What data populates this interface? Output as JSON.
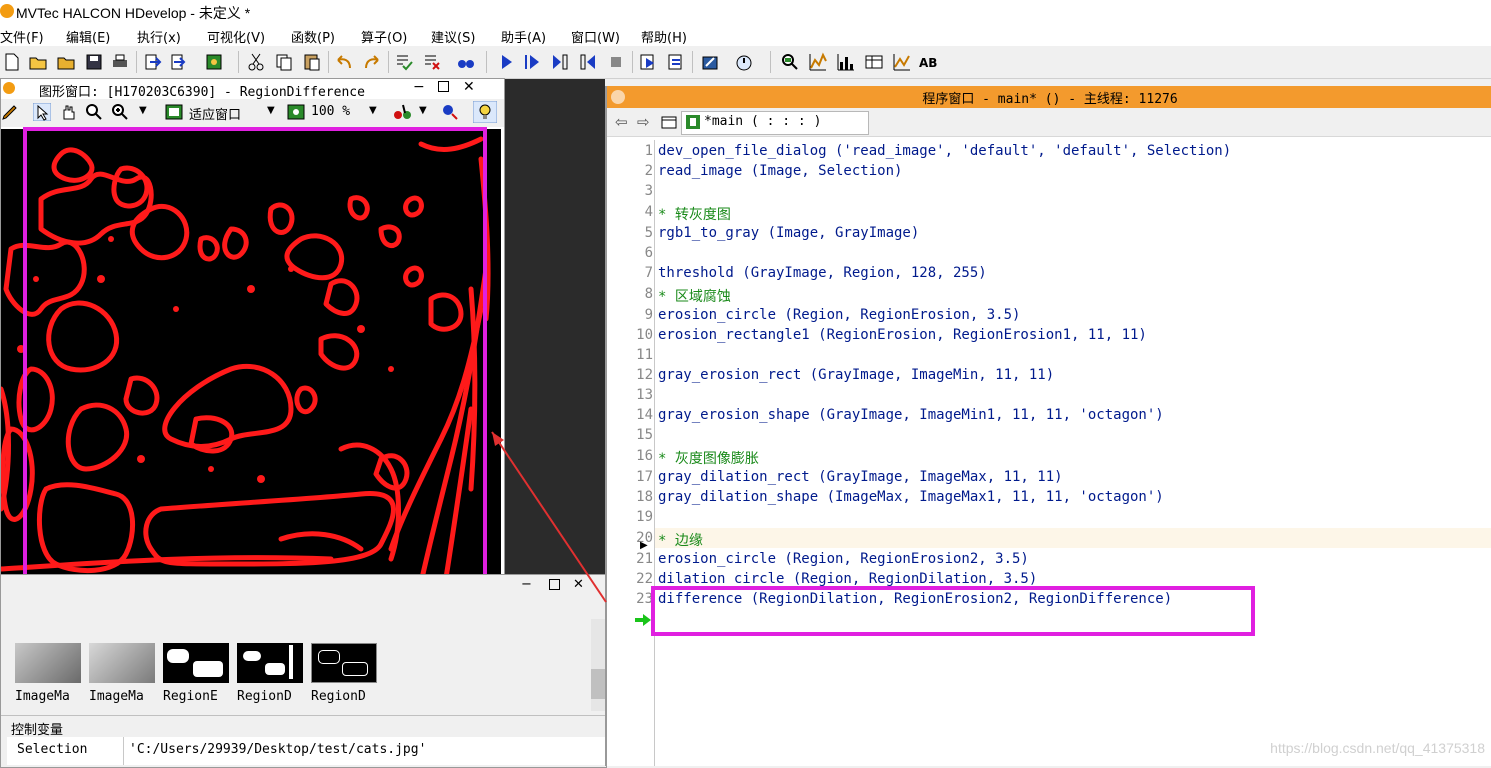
{
  "app": {
    "title": "MVTec HALCON HDevelop - 未定义 *"
  },
  "menu": [
    "文件(F)",
    "编辑(E)",
    "执行(x)",
    "可视化(V)",
    "函数(P)",
    "算子(O)",
    "建议(S)",
    "助手(A)",
    "窗口(W)",
    "帮助(H)"
  ],
  "graphics_window": {
    "title": "图形窗口: [H170203C6390] - RegionDifference",
    "fit_label": "适应窗口",
    "zoom_label": "100 %"
  },
  "variables": {
    "thumbnails": [
      "ImageMa",
      "ImageMa",
      "RegionE",
      "RegionD",
      "RegionD"
    ],
    "control_header": "控制变量",
    "control_var_name": "Selection",
    "control_var_value": "'C:/Users/29939/Desktop/test/cats.jpg'"
  },
  "program_window": {
    "title": "程序窗口 - main* () - 主线程: 11276",
    "procedure": "*main ( : : : )",
    "lines": [
      {
        "n": "1",
        "text": "dev_open_file_dialog ('read_image', 'default', 'default', Selection)",
        "comment": false
      },
      {
        "n": "2",
        "text": "read_image (Image, Selection)",
        "comment": false
      },
      {
        "n": "3",
        "text": "",
        "comment": false
      },
      {
        "n": "4",
        "text": "* 转灰度图",
        "comment": true
      },
      {
        "n": "5",
        "text": "rgb1_to_gray (Image, GrayImage)",
        "comment": false
      },
      {
        "n": "6",
        "text": "",
        "comment": false
      },
      {
        "n": "7",
        "text": "threshold (GrayImage, Region, 128, 255)",
        "comment": false
      },
      {
        "n": "8",
        "text": "* 区域腐蚀",
        "comment": true
      },
      {
        "n": "9",
        "text": "erosion_circle (Region, RegionErosion, 3.5)",
        "comment": false
      },
      {
        "n": "10",
        "text": "erosion_rectangle1 (RegionErosion, RegionErosion1, 11, 11)",
        "comment": false
      },
      {
        "n": "11",
        "text": "",
        "comment": false
      },
      {
        "n": "12",
        "text": "gray_erosion_rect (GrayImage, ImageMin, 11, 11)",
        "comment": false
      },
      {
        "n": "13",
        "text": "",
        "comment": false
      },
      {
        "n": "14",
        "text": "gray_erosion_shape (GrayImage, ImageMin1, 11, 11, 'octagon')",
        "comment": false
      },
      {
        "n": "15",
        "text": "",
        "comment": false
      },
      {
        "n": "16",
        "text": "* 灰度图像膨胀",
        "comment": true
      },
      {
        "n": "17",
        "text": "gray_dilation_rect (GrayImage, ImageMax, 11, 11)",
        "comment": false
      },
      {
        "n": "18",
        "text": "gray_dilation_shape (ImageMax, ImageMax1, 11, 11, 'octagon')",
        "comment": false
      },
      {
        "n": "19",
        "text": "",
        "comment": false
      },
      {
        "n": "20",
        "text": "* 边缘",
        "comment": true
      },
      {
        "n": "21",
        "text": "erosion_circle (Region, RegionErosion2, 3.5)",
        "comment": false
      },
      {
        "n": "22",
        "text": "dilation_circle (Region, RegionDilation, 3.5)",
        "comment": false
      },
      {
        "n": "23",
        "text": "difference (RegionDilation, RegionErosion2, RegionDifference)",
        "comment": false
      }
    ]
  },
  "watermark": "https://blog.csdn.net/qq_41375318",
  "colors": {
    "accent_orange": "#f39a2d",
    "annotation_magenta": "#e020e0",
    "region_red": "#ff0000",
    "code_blue": "#001a8c",
    "comment_green": "#1a8a1a"
  }
}
